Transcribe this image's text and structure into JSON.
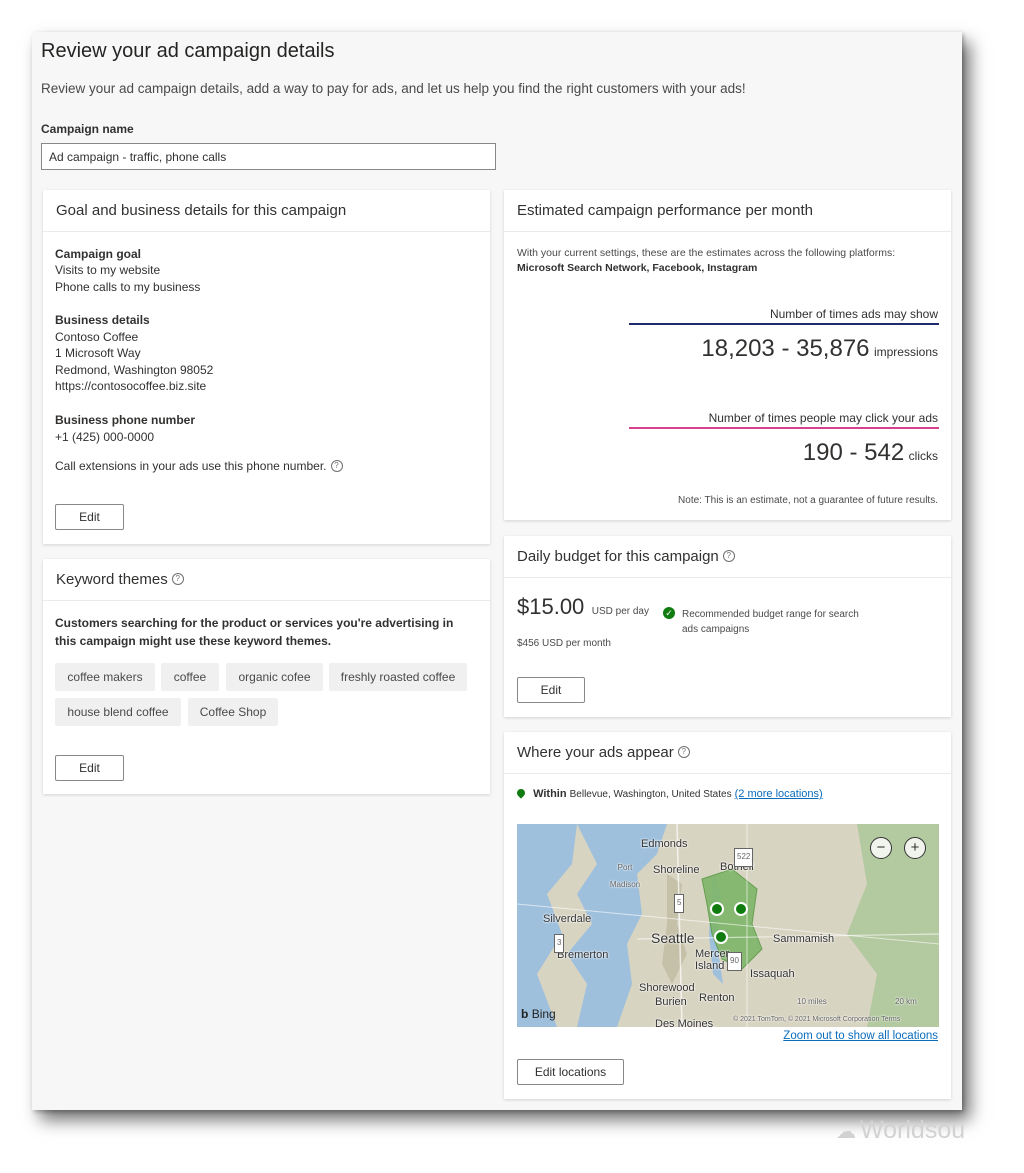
{
  "page": {
    "title": "Review your ad campaign details",
    "subtitle": "Review your ad campaign details, add a way to pay for ads, and let us help you find the right customers with your ads!",
    "campaign_name_label": "Campaign name",
    "campaign_name_value": "Ad campaign - traffic, phone calls"
  },
  "goal_card": {
    "title": "Goal and business details for this campaign",
    "goal_heading": "Campaign goal",
    "goals": [
      "Visits to my website",
      "Phone calls to my business"
    ],
    "business_heading": "Business details",
    "business": [
      "Contoso Coffee",
      "1 Microsoft Way",
      "Redmond, Washington 98052",
      "https://contosocoffee.biz.site"
    ],
    "phone_heading": "Business phone number",
    "phone": "+1 (425) 000-0000",
    "call_ext_note": "Call extensions in your ads use this phone number.",
    "edit_label": "Edit"
  },
  "keyword_card": {
    "title": "Keyword themes",
    "description": "Customers searching for the product or services you're advertising in this campaign might use these keyword themes.",
    "keywords": [
      "coffee makers",
      "coffee",
      "organic cofee",
      "freshly roasted coffee",
      "house blend coffee",
      "Coffee Shop"
    ],
    "edit_label": "Edit"
  },
  "performance_card": {
    "title": "Estimated campaign performance per month",
    "intro": "With your current settings, these are the estimates across the following platforms:",
    "platforms": "Microsoft Search Network, Facebook, Instagram",
    "impressions_label": "Number of times ads may show",
    "impressions_value": "18,203 - 35,876",
    "impressions_unit": "impressions",
    "impressions_color": "#1f2a6b",
    "clicks_label": "Number of times people may click your ads",
    "clicks_value": "190 - 542",
    "clicks_unit": "clicks",
    "clicks_color": "#d9418f",
    "note": "Note: This is an estimate, not a guarantee of future results."
  },
  "budget_card": {
    "title": "Daily budget for this campaign",
    "amount": "$15.00",
    "amount_unit": "USD per day",
    "monthly": "$456 USD per month",
    "recommendation": "Recommended budget range for search ads campaigns",
    "check_color": "#107c10",
    "edit_label": "Edit"
  },
  "location_card": {
    "title": "Where your ads appear",
    "within_label": "Within",
    "location": "Bellevue, Washington, United States",
    "more_locations": "(2 more locations)",
    "zoom_out_link": "Zoom out to show all locations",
    "edit_label": "Edit locations",
    "map": {
      "labels": [
        "Edmonds",
        "Port Madison",
        "Shoreline",
        "Bothell",
        "Silverdale",
        "Seattle",
        "Sammamish",
        "Bremerton",
        "Mercer Island",
        "Issaquah",
        "Shorewood",
        "Burien",
        "Renton",
        "Des Moines"
      ],
      "road_shields": [
        "522",
        "5",
        "3",
        "90"
      ],
      "zoom_out_symbol": "−",
      "zoom_in_symbol": "+",
      "brand": "Bing",
      "scale_miles": "10 miles",
      "scale_km": "20 km",
      "copyright": "© 2021 TomTom, © 2021 Microsoft Corporation",
      "terms": "Terms"
    }
  },
  "watermark": "Worldsou"
}
